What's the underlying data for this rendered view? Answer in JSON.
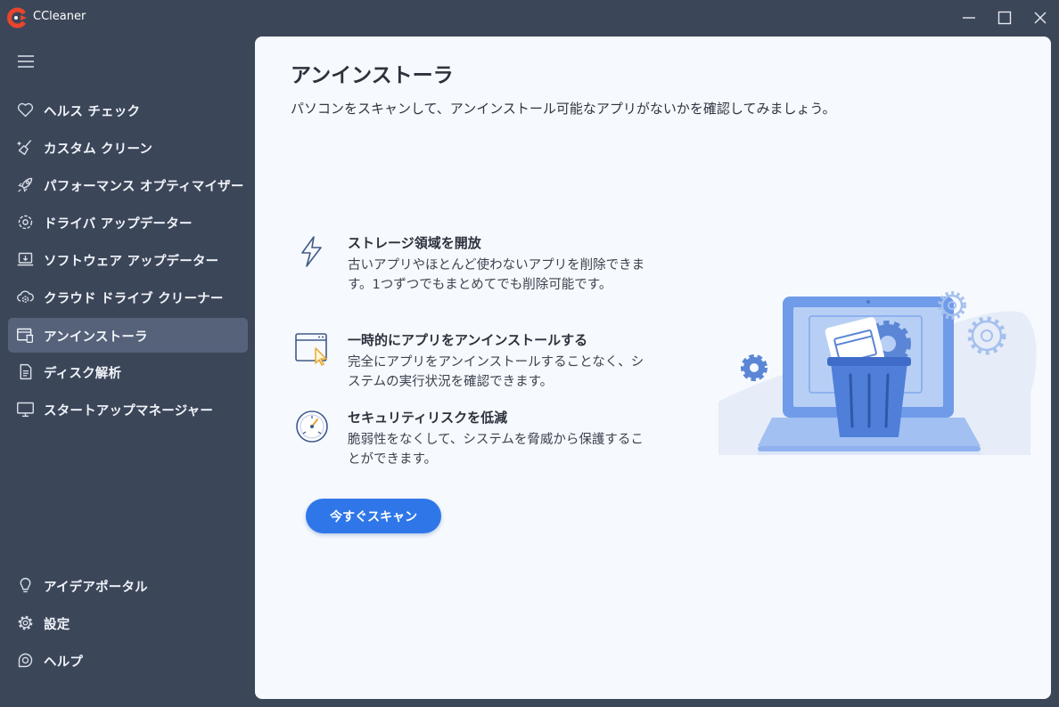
{
  "window": {
    "title": "CCleaner"
  },
  "sidebar": {
    "items": [
      {
        "label": "ヘルス チェック",
        "icon": "heart-icon"
      },
      {
        "label": "カスタム クリーン",
        "icon": "broom-icon"
      },
      {
        "label": "パフォーマンス オプティマイザー",
        "icon": "rocket-icon"
      },
      {
        "label": "ドライバ アップデーター",
        "icon": "driver-gear-icon"
      },
      {
        "label": "ソフトウェア アップデーター",
        "icon": "laptop-update-icon"
      },
      {
        "label": "クラウド ドライブ クリーナー",
        "icon": "cloud-gear-icon"
      },
      {
        "label": "アンインストーラ",
        "icon": "uninstall-icon",
        "active": true
      },
      {
        "label": "ディスク解析",
        "icon": "document-icon"
      },
      {
        "label": "スタートアップマネージャー",
        "icon": "monitor-icon"
      }
    ],
    "bottom_items": [
      {
        "label": "アイデアポータル",
        "icon": "lightbulb-icon"
      },
      {
        "label": "設定",
        "icon": "gear-icon"
      },
      {
        "label": "ヘルプ",
        "icon": "help-icon"
      }
    ]
  },
  "main": {
    "title": "アンインストーラ",
    "subtitle": "パソコンをスキャンして、アンインストール可能なアプリがないかを確認してみましょう。",
    "features": [
      {
        "title": "ストレージ領域を開放",
        "desc": "古いアプリやほとんど使わないアプリを削除できます。1つずつでもまとめてでも削除可能です。",
        "icon": "lightning-icon"
      },
      {
        "title": "一時的にアプリをアンインストールする",
        "desc": "完全にアプリをアンインストールすることなく、システムの実行状況を確認できます。",
        "icon": "window-cursor-icon"
      },
      {
        "title": "セキュリティリスクを低減",
        "desc": "脆弱性をなくして、システムを脅威から保護することができます。",
        "icon": "gauge-icon"
      }
    ],
    "scan_button": "今すぐスキャン"
  },
  "colors": {
    "sidebar_bg": "#3c4659",
    "active_item_bg": "#56627a",
    "panel_bg": "#f6f9fd",
    "accent": "#2f77e8"
  }
}
